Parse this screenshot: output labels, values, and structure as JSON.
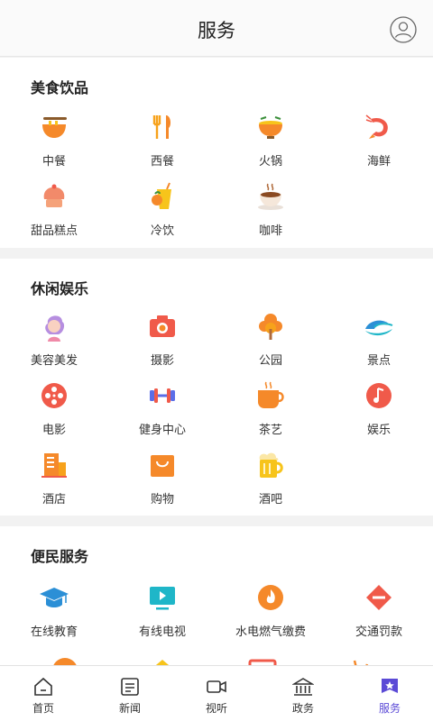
{
  "header": {
    "title": "服务"
  },
  "sections": [
    {
      "title": "美食饮品",
      "items": [
        {
          "label": "中餐",
          "icon": "noodle-bowl-icon"
        },
        {
          "label": "西餐",
          "icon": "fork-knife-icon"
        },
        {
          "label": "火锅",
          "icon": "hotpot-icon"
        },
        {
          "label": "海鲜",
          "icon": "shrimp-icon"
        },
        {
          "label": "甜品糕点",
          "icon": "cake-icon"
        },
        {
          "label": "冷饮",
          "icon": "cold-drink-icon"
        },
        {
          "label": "咖啡",
          "icon": "coffee-cup-icon"
        }
      ]
    },
    {
      "title": "休闲娱乐",
      "items": [
        {
          "label": "美容美发",
          "icon": "woman-hair-icon"
        },
        {
          "label": "摄影",
          "icon": "camera-icon"
        },
        {
          "label": "公园",
          "icon": "tree-icon"
        },
        {
          "label": "景点",
          "icon": "wave-icon"
        },
        {
          "label": "电影",
          "icon": "film-reel-icon"
        },
        {
          "label": "健身中心",
          "icon": "dumbbell-icon"
        },
        {
          "label": "茶艺",
          "icon": "tea-cup-icon"
        },
        {
          "label": "娱乐",
          "icon": "music-note-icon"
        },
        {
          "label": "酒店",
          "icon": "hotel-building-icon"
        },
        {
          "label": "购物",
          "icon": "shopping-bag-icon"
        },
        {
          "label": "酒吧",
          "icon": "beer-mug-icon"
        }
      ]
    },
    {
      "title": "便民服务",
      "items": [
        {
          "label": "在线教育",
          "icon": "graduation-cap-icon"
        },
        {
          "label": "有线电视",
          "icon": "tv-icon"
        },
        {
          "label": "水电燃气缴费",
          "icon": "flame-icon"
        },
        {
          "label": "交通罚款",
          "icon": "no-entry-icon"
        }
      ]
    }
  ],
  "tabs": [
    {
      "label": "首页",
      "icon": "home-icon",
      "active": false
    },
    {
      "label": "新闻",
      "icon": "news-icon",
      "active": false
    },
    {
      "label": "视听",
      "icon": "video-camera-icon",
      "active": false
    },
    {
      "label": "政务",
      "icon": "government-building-icon",
      "active": false
    },
    {
      "label": "服务",
      "icon": "service-flag-icon",
      "active": true
    }
  ],
  "colors": {
    "accent": "#5b4ad6",
    "orange": "#f5892a",
    "yellow": "#f7c41b",
    "red": "#f05a4a",
    "blue": "#2b8fd6",
    "teal": "#1fb6c8"
  }
}
